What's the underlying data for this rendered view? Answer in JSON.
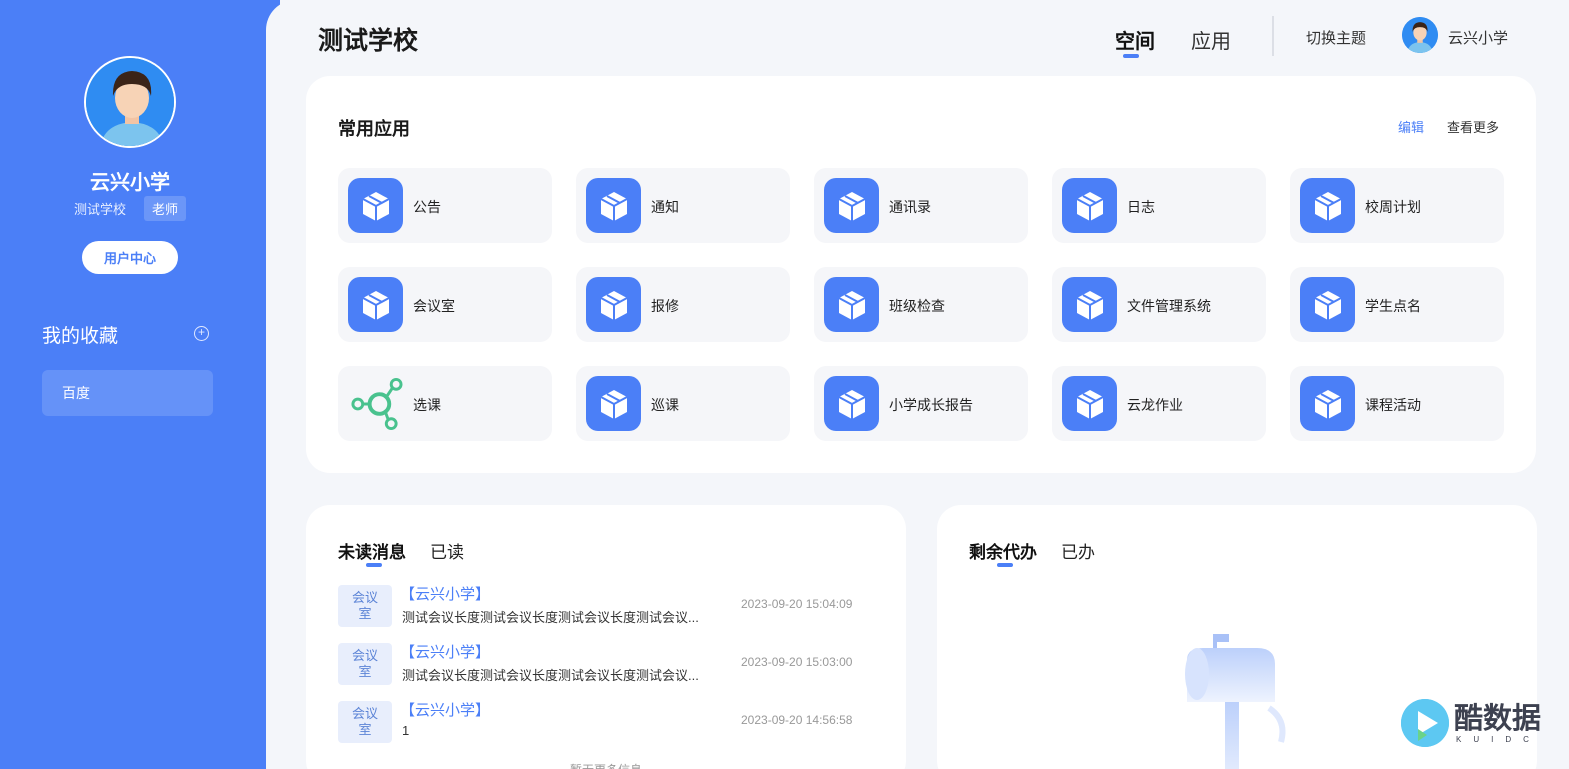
{
  "sidebar": {
    "school_name": "云兴小学",
    "sub_school": "测试学校",
    "role": "老师",
    "user_center_label": "用户中心",
    "favorites_title": "我的收藏",
    "favorites": [
      {
        "label": "百度"
      }
    ]
  },
  "header": {
    "title": "测试学校",
    "tabs": [
      {
        "label": "空间",
        "active": true
      },
      {
        "label": "应用",
        "active": false
      }
    ],
    "switch_theme_label": "切换主题",
    "user_name": "云兴小学"
  },
  "apps": {
    "title": "常用应用",
    "edit_label": "编辑",
    "more_label": "查看更多",
    "items": [
      {
        "label": "公告",
        "icon": "box-icon"
      },
      {
        "label": "通知",
        "icon": "box-icon"
      },
      {
        "label": "通讯录",
        "icon": "box-icon"
      },
      {
        "label": "日志",
        "icon": "box-icon"
      },
      {
        "label": "校周计划",
        "icon": "box-icon"
      },
      {
        "label": "会议室",
        "icon": "box-icon"
      },
      {
        "label": "报修",
        "icon": "box-icon"
      },
      {
        "label": "班级检查",
        "icon": "box-icon"
      },
      {
        "label": "文件管理系统",
        "icon": "box-icon"
      },
      {
        "label": "学生点名",
        "icon": "box-icon"
      },
      {
        "label": "选课",
        "icon": "network-icon"
      },
      {
        "label": "巡课",
        "icon": "box-icon"
      },
      {
        "label": "小学成长报告",
        "icon": "box-icon"
      },
      {
        "label": "云龙作业",
        "icon": "box-icon"
      },
      {
        "label": "课程活动",
        "icon": "box-icon"
      }
    ]
  },
  "messages": {
    "tab_unread": "未读消息",
    "tab_read": "已读",
    "items": [
      {
        "tag": "会议室",
        "sender": "【云兴小学】",
        "body": "测试会议长度测试会议长度测试会议长度测试会议...",
        "time": "2023-09-20 15:04:09"
      },
      {
        "tag": "会议室",
        "sender": "【云兴小学】",
        "body": "测试会议长度测试会议长度测试会议长度测试会议...",
        "time": "2023-09-20 15:03:00"
      },
      {
        "tag": "会议室",
        "sender": "【云兴小学】",
        "body": "1",
        "time": "2023-09-20 14:56:58"
      }
    ],
    "footer": "暂无更多信息"
  },
  "todo": {
    "tab_pending": "剩余代办",
    "tab_done": "已办"
  },
  "watermark": {
    "text": "酷数据",
    "sub": "KUIDC"
  },
  "colors": {
    "accent": "#4b7ff7",
    "background": "#f4f6fa",
    "app_green": "#49c28e"
  }
}
